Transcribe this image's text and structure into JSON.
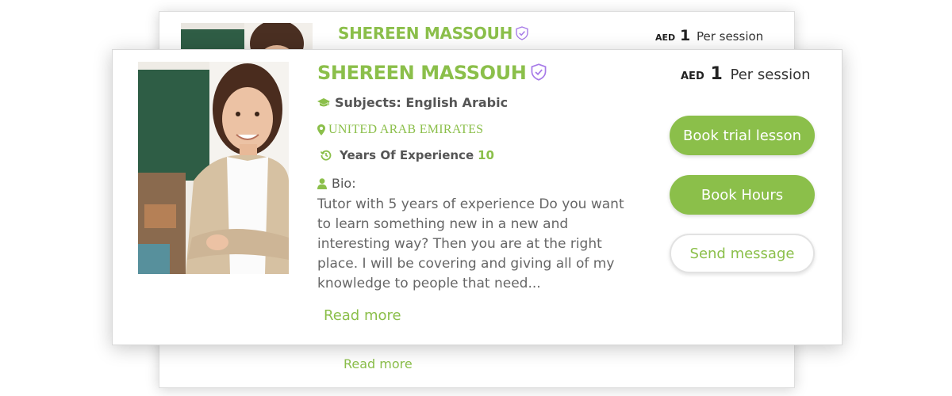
{
  "back_card": {
    "name": "SHEREEN MASSOUH",
    "price": {
      "currency": "AED",
      "amount": "1",
      "unit": "Per session"
    },
    "read_more": "Read more"
  },
  "tutor": {
    "name": "SHEREEN MASSOUH",
    "subjects": "Subjects: English Arabic",
    "country": "UNITED ARAB EMIRATES",
    "experience_label": "Years Of Experience",
    "experience_value": "10",
    "bio_label": "Bio:",
    "bio_text": "Tutor with 5 years of experience Do you want to learn something new in a new and interesting way? Then you are at the right place. I will be covering and giving all of my knowledge to people that need...",
    "read_more": "Read more"
  },
  "price": {
    "currency": "AED",
    "amount": "1",
    "unit": "Per session"
  },
  "actions": {
    "book_trial": "Book trial lesson",
    "book_hours": "Book Hours",
    "send_message": "Send message"
  },
  "icons": {
    "verified": "shield-check-icon",
    "subjects": "graduation-cap-icon",
    "country": "map-marker-icon",
    "experience": "history-icon",
    "bio": "user-icon"
  },
  "colors": {
    "accent": "#8bbf4a",
    "badge": "#a77be8",
    "text": "#555555"
  }
}
